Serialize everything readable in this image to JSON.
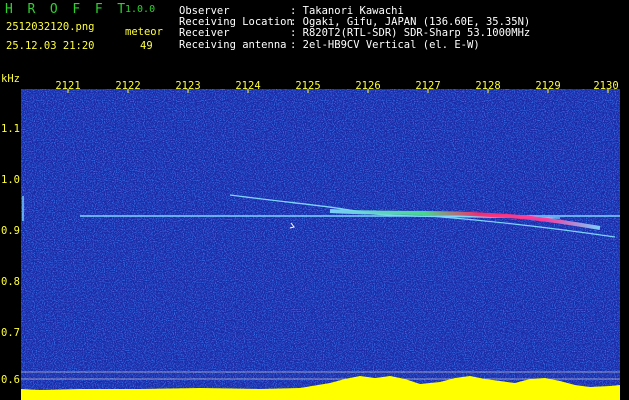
{
  "header": {
    "app_name": "H R O F F T",
    "version": "1.0.0",
    "file_name": "2512032120.png",
    "timestamp": "25.12.03 21:20",
    "count_label": "meteor",
    "count_value": "49",
    "fields": [
      {
        "label": "Observer",
        "value": ": Takanori Kawachi"
      },
      {
        "label": "Receiving Location",
        "value": ": Ogaki, Gifu, JAPAN (136.60E, 35.35N)"
      },
      {
        "label": "Receiver",
        "value": ": R820T2(RTL-SDR) SDR-Sharp 53.1000MHz"
      },
      {
        "label": "Receiving antenna",
        "value": ": 2el-HB9CV Vertical (el. E-W)"
      }
    ]
  },
  "spectrogram": {
    "y_unit": "kHz",
    "y_ticks": [
      "1.1",
      "1.0",
      "0.9",
      "0.8",
      "0.7",
      "0.6"
    ],
    "x_ticks": [
      "2121",
      "2122",
      "2123",
      "2124",
      "2125",
      "2126",
      "2127",
      "2128",
      "2129",
      "2130"
    ]
  },
  "colors": {
    "background": "#000000",
    "noise_base": "#1a2aa8",
    "header_green": "#2fd12f",
    "header_yellow": "#ffff3a",
    "carrier": "#7fd4ff",
    "meteor_hot": "#ff2a6a",
    "signal_level": "#ffff00"
  }
}
